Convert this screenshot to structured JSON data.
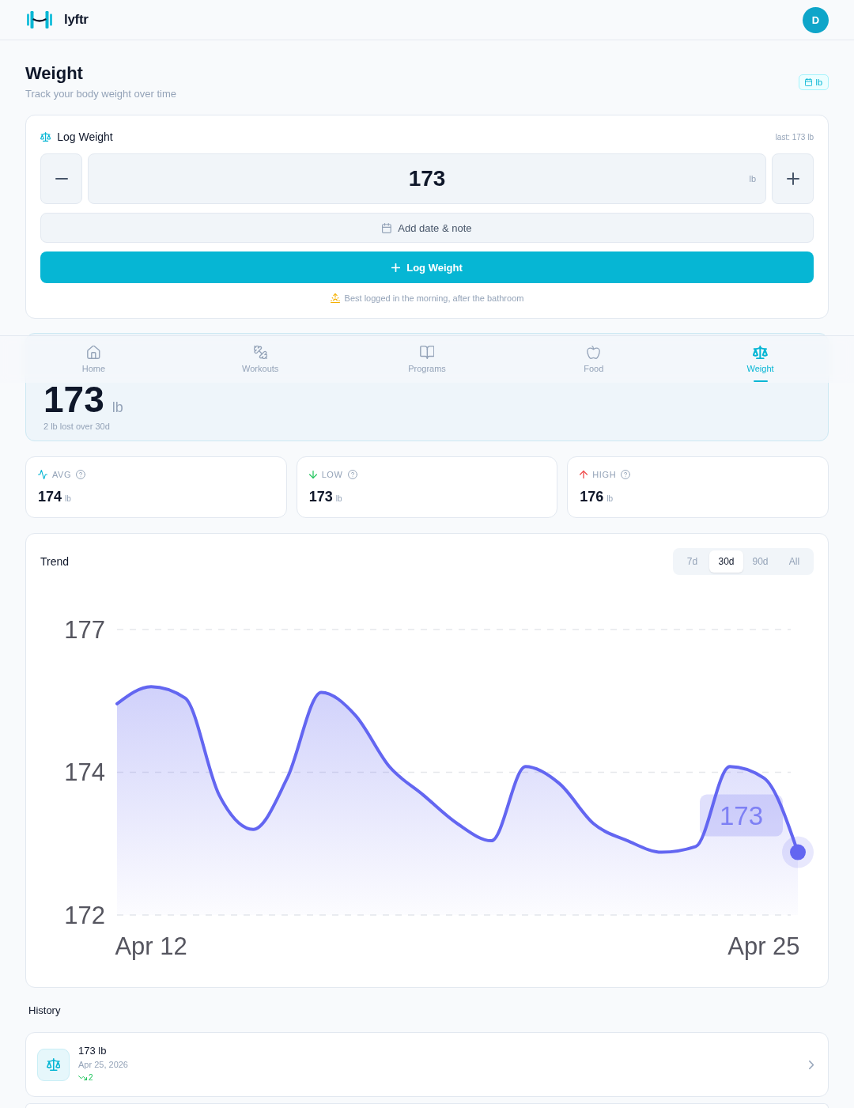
{
  "header": {
    "app_name": "lyftr",
    "avatar": "D"
  },
  "page": {
    "title": "Weight",
    "subtitle": "Track your body weight over time",
    "unit_badge": "lb"
  },
  "log_weight": {
    "title": "Log Weight",
    "last_entry": "last: 173 lb",
    "value": "173",
    "unit": "lb",
    "date_note_button": "Add date & note",
    "submit_button": "Log Weight",
    "tip": "Best logged in the morning, after the bathroom"
  },
  "nav": [
    {
      "kind": "home",
      "label": "Home",
      "selected": false
    },
    {
      "kind": "workouts",
      "label": "Workouts",
      "selected": false
    },
    {
      "kind": "programs",
      "label": "Programs",
      "selected": false
    },
    {
      "kind": "food",
      "label": "Food",
      "selected": false
    },
    {
      "kind": "weight",
      "label": "Weight",
      "selected": true
    }
  ],
  "current_weight": {
    "value": "173",
    "unit": "lb",
    "change": "2 lb lost over 30d"
  },
  "stats": [
    {
      "kind": "avg",
      "label": "AVG",
      "value": "174",
      "unit": "lb"
    },
    {
      "kind": "low",
      "label": "LOW",
      "value": "173",
      "unit": "lb"
    },
    {
      "kind": "high",
      "label": "HIGH",
      "value": "176",
      "unit": "lb"
    }
  ],
  "trend": {
    "title": "Trend",
    "ranges": [
      {
        "label": "7d",
        "selected": false
      },
      {
        "label": "30d",
        "selected": true
      },
      {
        "label": "90d",
        "selected": false
      },
      {
        "label": "All",
        "selected": false
      }
    ],
    "chart_data": {
      "type": "area",
      "categories": [
        null,
        "Apr 12",
        null,
        null,
        null,
        null,
        null,
        null,
        null,
        null,
        null,
        null,
        null,
        null,
        null,
        null,
        null,
        null,
        null,
        "Apr 25",
        null
      ],
      "series": [
        {
          "color": "#6366f1",
          "values": [
            175.7,
            176.0,
            175.8,
            174.1,
            173.5,
            174.4,
            175.9,
            175.5,
            174.6,
            174.1,
            173.6,
            173.3,
            174.6,
            174.3,
            173.6,
            173.3,
            173.1,
            173.2,
            174.6,
            174.4,
            173.1
          ]
        }
      ],
      "ylim": [
        172,
        177
      ],
      "yticks": [
        {
          "value": 172,
          "label": "172"
        },
        {
          "value": 174.5,
          "label": "174"
        },
        {
          "value": 177,
          "label": "177"
        }
      ],
      "annotations": [
        "173"
      ]
    }
  },
  "history": {
    "title": "History",
    "entries": [
      {
        "weight": "173 lb",
        "date": "Apr 25, 2026",
        "change": "2",
        "kind": "down"
      }
    ]
  }
}
